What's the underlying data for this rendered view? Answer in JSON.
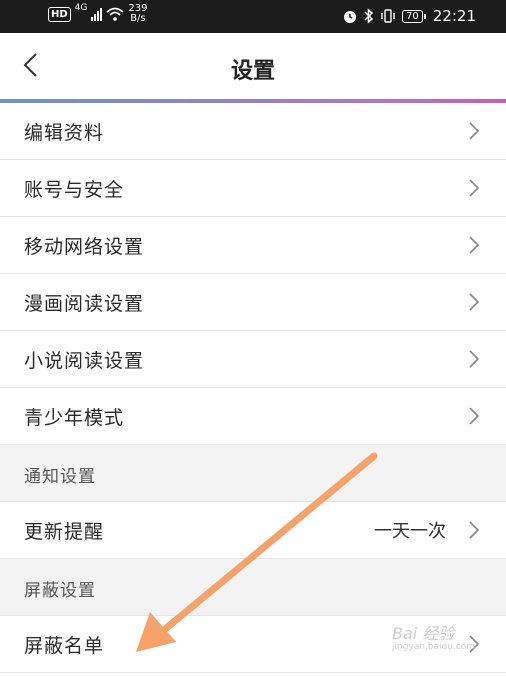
{
  "status": {
    "hd": "HD",
    "network": "4G",
    "speed_value": "239",
    "speed_unit": "B/s",
    "battery": "70",
    "time": "22:21"
  },
  "header": {
    "title": "设置"
  },
  "items": [
    {
      "label": "编辑资料"
    },
    {
      "label": "账号与安全"
    },
    {
      "label": "移动网络设置"
    },
    {
      "label": "漫画阅读设置"
    },
    {
      "label": "小说阅读设置"
    },
    {
      "label": "青少年模式"
    }
  ],
  "notify_section": {
    "label": "通知设置"
  },
  "update_item": {
    "label": "更新提醒",
    "value": "一天一次"
  },
  "block_section": {
    "label": "屏蔽设置"
  },
  "block_item": {
    "label": "屏蔽名单"
  },
  "watermark": {
    "text": "Bai 经验",
    "sub": "jingyan.baidu.com"
  },
  "colors": {
    "accent_gradient_start": "#6e8fcf",
    "accent_gradient_end": "#c45fb6",
    "arrow": "#f5a36a"
  }
}
